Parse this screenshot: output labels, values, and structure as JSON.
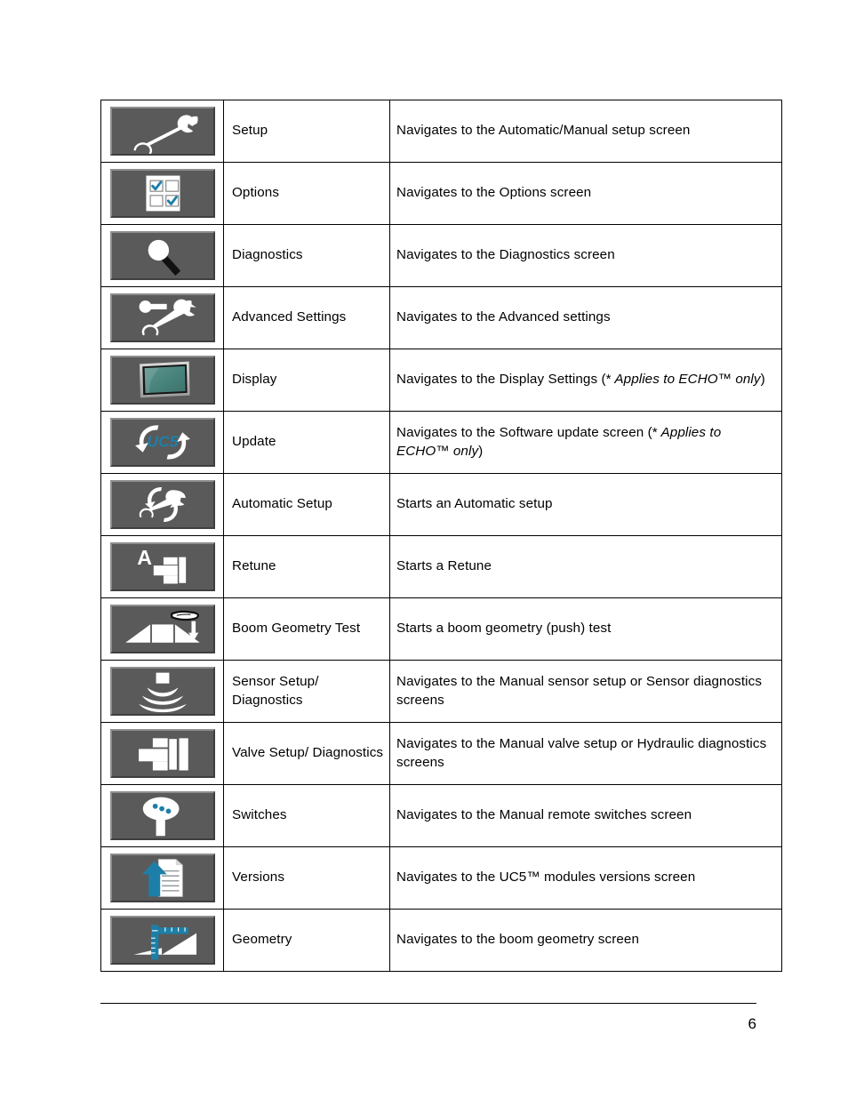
{
  "page": {
    "number": "6"
  },
  "table": {
    "rows": [
      {
        "icon": "wrench-icon",
        "label": "Setup",
        "desc_pre": "Navigates to the Automatic/Manual setup screen",
        "desc_em": "",
        "desc_post": ""
      },
      {
        "icon": "checkbox-options-icon",
        "label": "Options",
        "desc_pre": "Navigates to the Options screen",
        "desc_em": "",
        "desc_post": ""
      },
      {
        "icon": "magnifier-diagnostics-icon",
        "label": "Diagnostics",
        "desc_pre": "Navigates to the Diagnostics screen",
        "desc_em": "",
        "desc_post": ""
      },
      {
        "icon": "advanced-wrench-icon",
        "label": "Advanced Settings",
        "desc_pre": "Navigates to the Advanced settings",
        "desc_em": "",
        "desc_post": ""
      },
      {
        "icon": "display-monitor-icon",
        "label": "Display",
        "desc_pre": "Navigates to the Display Settings (*",
        "desc_em": " Applies to ECHO™ only",
        "desc_post": ")"
      },
      {
        "icon": "uc5-update-icon",
        "label": "Update",
        "desc_pre": "Navigates to the Software update screen (*",
        "desc_em": " Applies to ECHO™ only",
        "desc_post": ")"
      },
      {
        "icon": "automatic-setup-icon",
        "label": "Automatic Setup",
        "desc_pre": "Starts an Automatic setup",
        "desc_em": "",
        "desc_post": ""
      },
      {
        "icon": "retune-valve-icon",
        "label": "Retune",
        "desc_pre": "Starts a Retune",
        "desc_em": "",
        "desc_post": ""
      },
      {
        "icon": "boom-geometry-test-icon",
        "label": "Boom Geometry Test",
        "desc_pre": "Starts a boom geometry (push) test",
        "desc_em": "",
        "desc_post": ""
      },
      {
        "icon": "sensor-waves-icon",
        "label": "Sensor Setup/ Diagnostics",
        "desc_pre": "Navigates to the Manual sensor setup or Sensor diagnostics screens",
        "desc_em": "",
        "desc_post": ""
      },
      {
        "icon": "valve-icon",
        "label": "Valve Setup/ Diagnostics",
        "desc_pre": "Navigates to the Manual valve setup or Hydraulic diagnostics screens",
        "desc_em": "",
        "desc_post": ""
      },
      {
        "icon": "switches-knob-icon",
        "label": "Switches",
        "desc_pre": "Navigates to the Manual remote switches screen",
        "desc_em": "",
        "desc_post": ""
      },
      {
        "icon": "versions-document-icon",
        "label": "Versions",
        "desc_pre": "Navigates to the UC5™ modules versions screen",
        "desc_em": "",
        "desc_post": ""
      },
      {
        "icon": "geometry-ruler-icon",
        "label": "Geometry",
        "desc_pre": "Navigates to the boom geometry screen",
        "desc_em": "",
        "desc_post": ""
      }
    ]
  },
  "colors": {
    "tile_bg": "#5a5a5a",
    "glyph_white": "#ffffff",
    "accent_blue": "#1d7fa8",
    "display_screen": "#4e8a83"
  }
}
